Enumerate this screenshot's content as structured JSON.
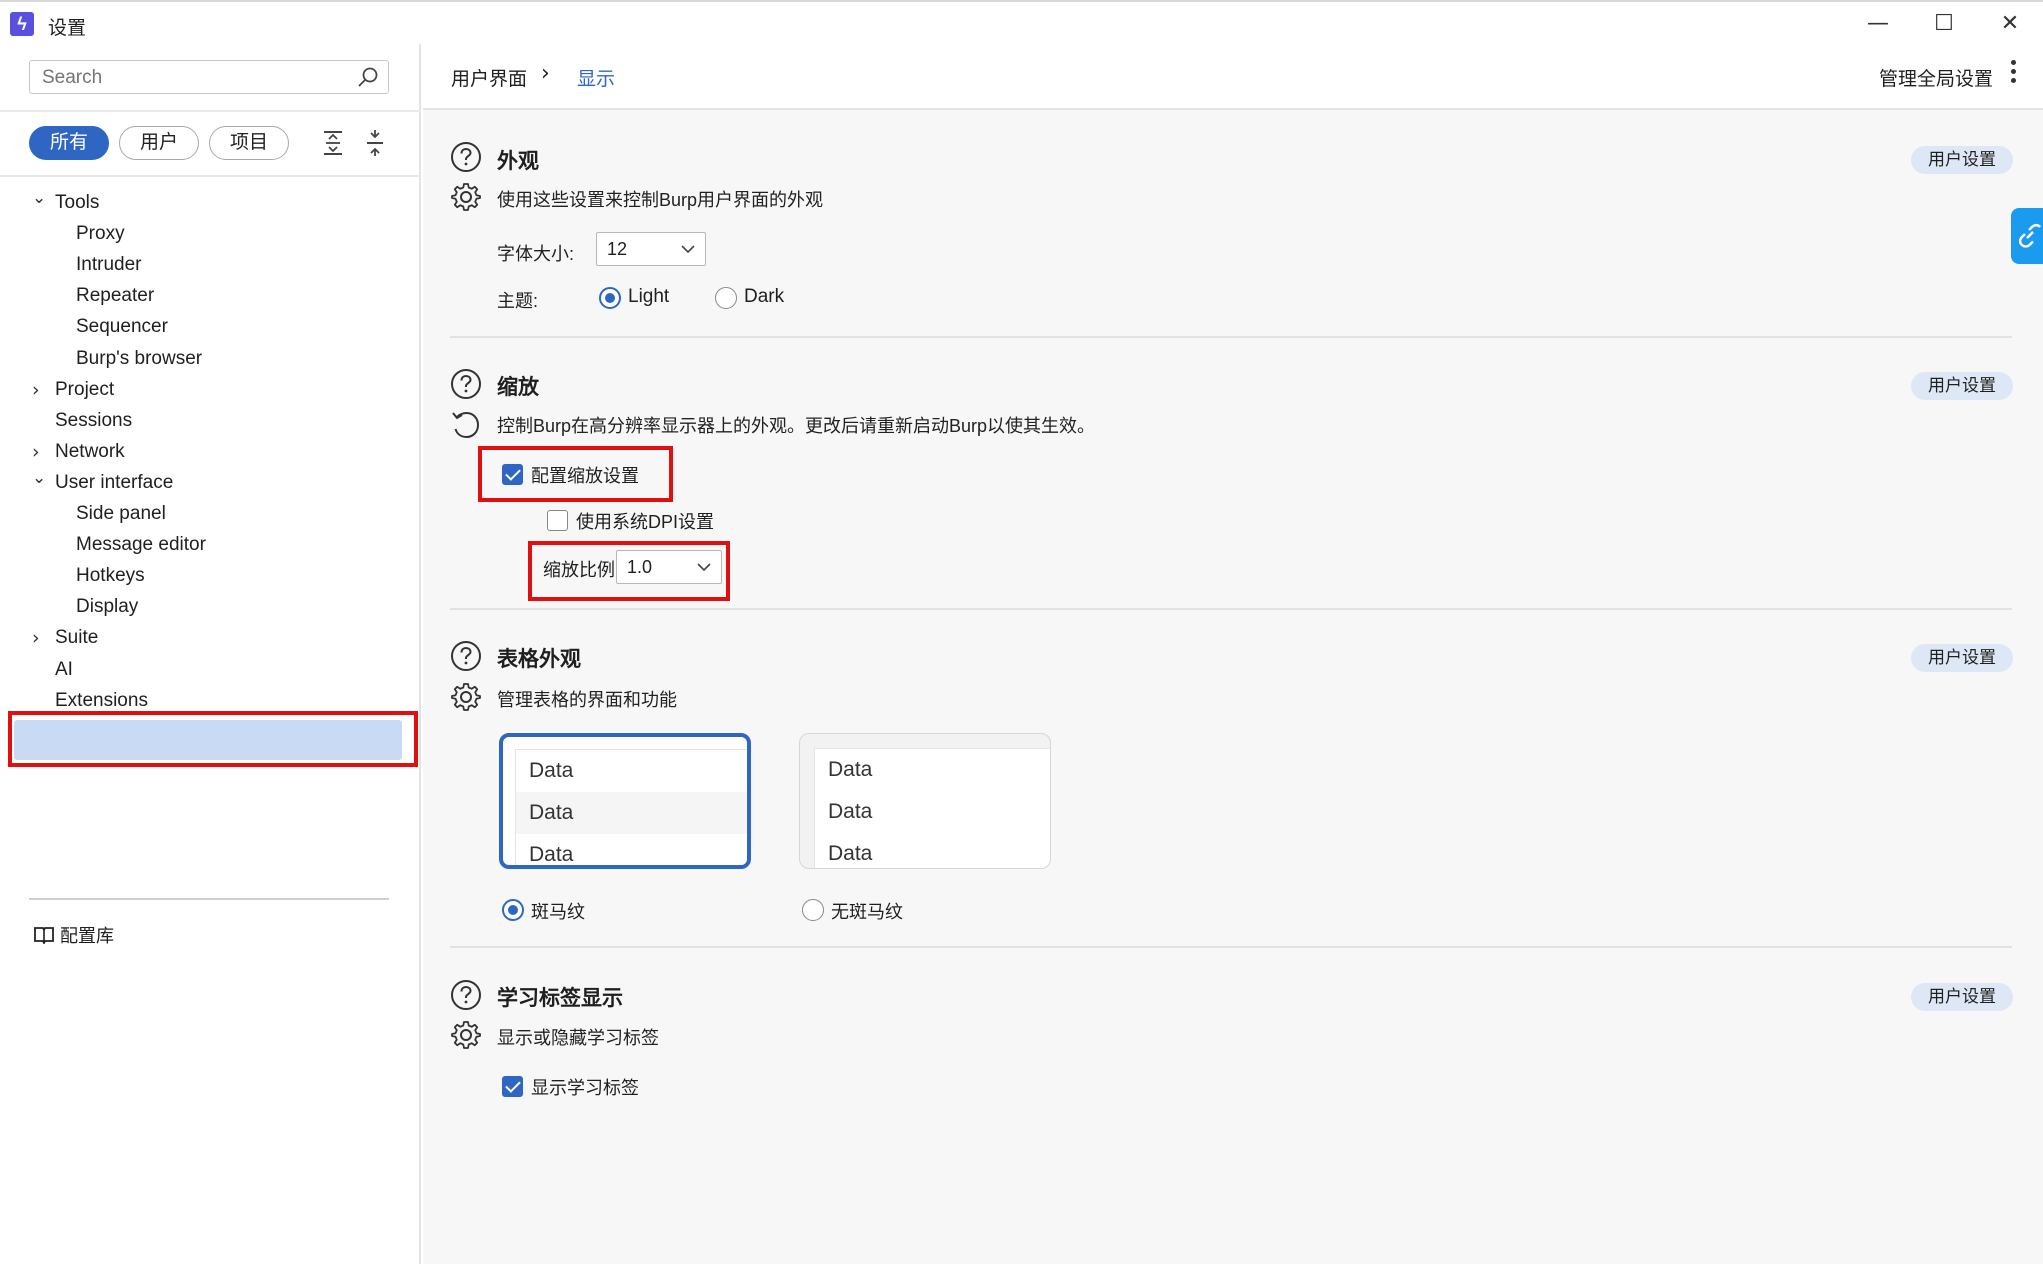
{
  "window": {
    "title": "设置",
    "minimize": "—",
    "maximize": "☐",
    "close": "✕"
  },
  "sidebar": {
    "search_placeholder": "Search",
    "filters": [
      "所有",
      "用户",
      "项目"
    ],
    "tree": [
      {
        "label": "Tools",
        "expanded": true,
        "level": 0
      },
      {
        "label": "Proxy",
        "level": 1
      },
      {
        "label": "Intruder",
        "level": 1
      },
      {
        "label": "Repeater",
        "level": 1
      },
      {
        "label": "Sequencer",
        "level": 1
      },
      {
        "label": "Burp's browser",
        "level": 1
      },
      {
        "label": "Project",
        "expanded": false,
        "level": 0
      },
      {
        "label": "Sessions",
        "level": 0
      },
      {
        "label": "Network",
        "expanded": false,
        "level": 0
      },
      {
        "label": "User interface",
        "expanded": true,
        "level": 0
      },
      {
        "label": "Side panel",
        "level": 1
      },
      {
        "label": "Message editor",
        "level": 1
      },
      {
        "label": "Hotkeys",
        "level": 1
      },
      {
        "label": "Display",
        "level": 1,
        "selected": true
      },
      {
        "label": "Suite",
        "expanded": false,
        "level": 0
      },
      {
        "label": "AI",
        "level": 0
      },
      {
        "label": "Extensions",
        "level": 0
      }
    ],
    "library": "配置库"
  },
  "header": {
    "breadcrumb_parent": "用户界面",
    "breadcrumb_sep": "›",
    "breadcrumb_current": "显示",
    "global_settings": "管理全局设置"
  },
  "sections": {
    "appearance": {
      "title": "外观",
      "description": "使用这些设置来控制Burp用户界面的外观",
      "badge": "用户设置",
      "font_size_label": "字体大小:",
      "font_size_value": "12",
      "theme_label": "主题:",
      "theme_options": [
        "Light",
        "Dark"
      ],
      "theme_selected": "Light"
    },
    "scaling": {
      "title": "缩放",
      "description": "控制Burp在高分辨率显示器上的外观。更改后请重新启动Burp以使其生效。",
      "badge": "用户设置",
      "configure_scaling": "配置缩放设置",
      "configure_scaling_checked": true,
      "use_system_dpi": "使用系统DPI设置",
      "use_system_dpi_checked": false,
      "scale_label": "缩放比例",
      "scale_value": "1.0"
    },
    "table": {
      "title": "表格外观",
      "description": "管理表格的界面和功能",
      "badge": "用户设置",
      "preview_rows": [
        "Data",
        "Data",
        "Data"
      ],
      "striped_label": "斑马纹",
      "plain_label": "无斑马纹",
      "selected": "斑马纹"
    },
    "learn": {
      "title": "学习标签显示",
      "description": "显示或隐藏学习标签",
      "badge": "用户设置",
      "show_label": "显示学习标签",
      "show_checked": true
    }
  },
  "colors": {
    "accent": "#2f66c4",
    "highlight_red": "#e01010",
    "selection": "#c9daf4"
  }
}
